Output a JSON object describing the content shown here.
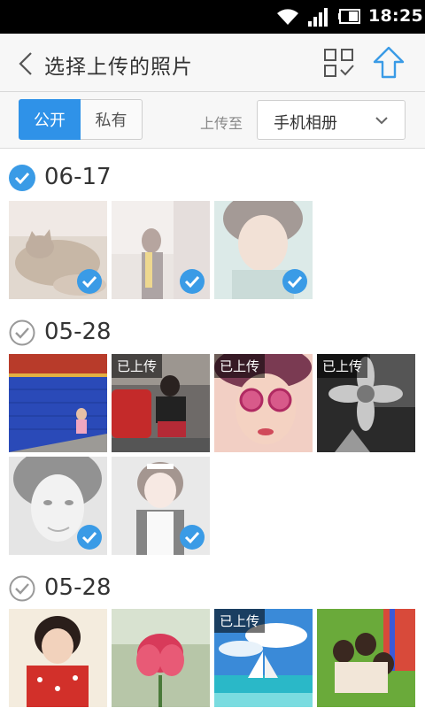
{
  "status_bar": {
    "time": "18:25",
    "icons": [
      "wifi-icon",
      "signal-icon",
      "battery-icon"
    ]
  },
  "header": {
    "title": "选择上传的照片",
    "back_icon": "chevron-left-icon",
    "select_all_icon": "grid-check-icon",
    "upload_icon": "upload-arrow-icon"
  },
  "options": {
    "visibility_tabs": [
      {
        "label": "公开",
        "selected": true
      },
      {
        "label": "私有",
        "selected": false
      }
    ],
    "upload_to_label": "上传至",
    "album_value": "手机相册"
  },
  "sections": [
    {
      "date": "06-17",
      "checked": true,
      "photos": [
        {
          "desc": "cat",
          "selected": true,
          "uploaded": false
        },
        {
          "desc": "girl-yellow-scarf",
          "selected": true,
          "uploaded": false
        },
        {
          "desc": "girl-closeup",
          "selected": true,
          "uploaded": false
        }
      ]
    },
    {
      "date": "05-28",
      "checked": false,
      "photos": [
        {
          "desc": "blue-wall-child",
          "selected": false,
          "uploaded": false
        },
        {
          "desc": "girl-camera-red-car",
          "selected": false,
          "uploaded": true
        },
        {
          "desc": "girl-sunglasses",
          "selected": false,
          "uploaded": true
        },
        {
          "desc": "flower-bw",
          "selected": false,
          "uploaded": true
        },
        {
          "desc": "girl-bw-portrait",
          "selected": true,
          "uploaded": false
        },
        {
          "desc": "girl-maid",
          "selected": true,
          "uploaded": false
        }
      ]
    },
    {
      "date": "05-28",
      "checked": false,
      "photos": [
        {
          "desc": "girl-red-dress",
          "selected": false,
          "uploaded": false
        },
        {
          "desc": "pink-flower",
          "selected": false,
          "uploaded": false
        },
        {
          "desc": "sailboat-sea",
          "selected": false,
          "uploaded": true
        },
        {
          "desc": "group-grass",
          "selected": false,
          "uploaded": false
        }
      ]
    }
  ],
  "uploaded_badge_label": "已上传",
  "colors": {
    "accent": "#2f92e8",
    "check_blue": "#3a9be6"
  }
}
